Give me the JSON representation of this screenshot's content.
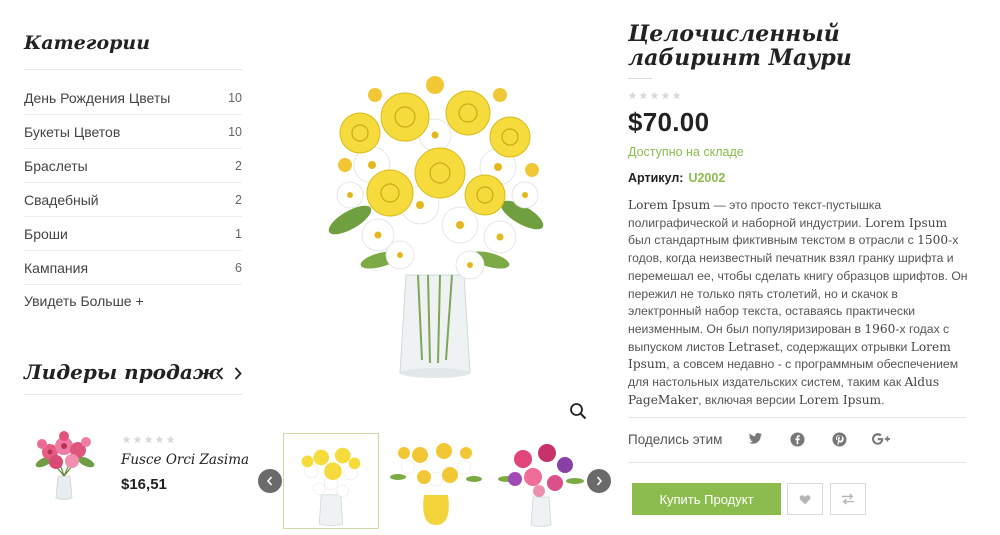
{
  "sidebar": {
    "categories_title": "Категории",
    "categories": [
      {
        "label": "День Рождения Цветы",
        "count": "10"
      },
      {
        "label": "Букеты Цветов",
        "count": "10"
      },
      {
        "label": "Браслеты",
        "count": "2"
      },
      {
        "label": "Свадебный",
        "count": "2"
      },
      {
        "label": "Броши",
        "count": "1"
      },
      {
        "label": "Кампания",
        "count": "6"
      }
    ],
    "see_more": "Увидеть Больше +",
    "bestsellers_title": "Лидеры продаж",
    "bestseller": {
      "name": "Fusce Orci Zasima",
      "price": "$16,51",
      "rating": 0
    }
  },
  "product": {
    "title": "Целочисленный лабиринт Маури",
    "rating": 0,
    "price": "$70.00",
    "stock": "Доступно на складе",
    "sku_label": "Артикул:",
    "sku": "U2002",
    "description": [
      {
        "t": "Lorem Ipsum",
        "serif": true
      },
      {
        "t": " — это просто текст-пустышка полиграфической и наборной индустрии. ",
        "serif": false
      },
      {
        "t": "Lorem Ipsum",
        "serif": true
      },
      {
        "t": " был стандартным фиктивным текстом в отрасли с ",
        "serif": false
      },
      {
        "t": "1500",
        "serif": true
      },
      {
        "t": "-х годов, когда неизвестный печатник взял гранку шрифта и перемешал ее, чтобы сделать книгу образцов шрифтов. Он пережил не только пять столетий, но и скачок в электронный набор текста, оставаясь практически неизменным. Он был популяризирован в ",
        "serif": false
      },
      {
        "t": "1960",
        "serif": true
      },
      {
        "t": "-х годах с выпуском листов ",
        "serif": false
      },
      {
        "t": "Letraset",
        "serif": true
      },
      {
        "t": ", содержащих отрывки ",
        "serif": false
      },
      {
        "t": "Lorem Ipsum",
        "serif": true
      },
      {
        "t": ", а совсем недавно - с программным обеспечением для настольных издательских систем, таким как ",
        "serif": false
      },
      {
        "t": "Aldus PageMaker",
        "serif": true
      },
      {
        "t": ", включая версии ",
        "serif": false
      },
      {
        "t": "Lorem Ipsum",
        "serif": true
      },
      {
        "t": ".",
        "serif": false
      }
    ],
    "share_label": "Поделись этим",
    "share_icons": [
      "twitter-icon",
      "facebook-icon",
      "pinterest-icon",
      "google-plus-icon"
    ],
    "buy_label": "Купить Продукт"
  },
  "colors": {
    "accent": "#8cbc4e",
    "star": "#d9d9d9",
    "arrow_bg": "#6a6a6a"
  }
}
